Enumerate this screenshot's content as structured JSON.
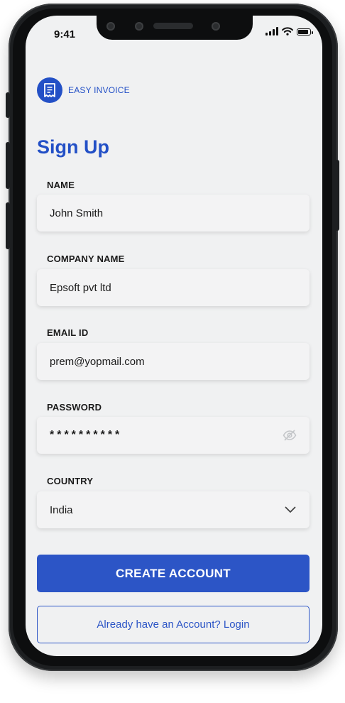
{
  "status_bar": {
    "time": "9:41"
  },
  "brand": {
    "name": "EASY INVOICE"
  },
  "page": {
    "title": "Sign Up"
  },
  "form": {
    "name": {
      "label": "NAME",
      "value": "John Smith"
    },
    "company": {
      "label": "COMPANY NAME",
      "value": "Epsoft pvt ltd"
    },
    "email": {
      "label": "EMAIL ID",
      "value": "prem@yopmail.com"
    },
    "password": {
      "label": "PASSWORD",
      "value": "**********"
    },
    "country": {
      "label": "COUNTRY",
      "value": "India"
    }
  },
  "actions": {
    "create_label": "CREATE ACCOUNT",
    "login_label": "Already have an Account? Login"
  },
  "colors": {
    "accent": "#2c55c6",
    "brand": "#2350c6"
  },
  "icons": [
    "signal-icon",
    "wifi-icon",
    "battery-icon",
    "invoice-icon",
    "eye-off-icon",
    "chevron-down-icon"
  ]
}
